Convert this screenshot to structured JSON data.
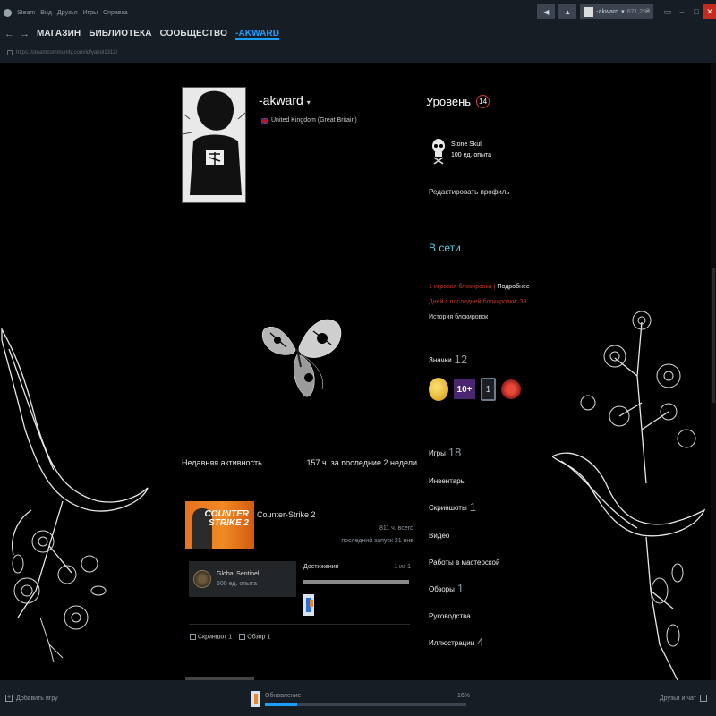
{
  "menu": [
    "Steam",
    "Вид",
    "Друзья",
    "Игры",
    "Справка"
  ],
  "titlebar": {
    "username": "-akward",
    "balance": "671,29₴"
  },
  "nav": {
    "items": [
      "МАГАЗИН",
      "БИБЛИОТЕКА",
      "СООБЩЕСТВО",
      "-AKWARD"
    ]
  },
  "url": "https://steamcommunity.com/id/yahol1312/",
  "profile": {
    "name": "-akward",
    "country": "United Kingdom (Great Britain)"
  },
  "recent": {
    "title": "Недавняя активность",
    "hours": "157 ч. за последние 2 недели",
    "game": {
      "name": "Counter-Strike 2",
      "logo_line1": "COUNTER",
      "logo_line2": "STRIKE 2",
      "total": "811 ч. всего",
      "last": "последний запуск 21 янв"
    },
    "badge": {
      "name": "Global Sentinel",
      "xp": "500 ед. опыта"
    },
    "achievements": {
      "label": "Достижения",
      "count": "1 из 1",
      "progress": 1.0
    },
    "screenshot": "Скриншот 1",
    "review": "Обзор 1"
  },
  "sidebar": {
    "level_label": "Уровень",
    "level": "14",
    "featured_badge": {
      "name": "Stone Skull",
      "xp": "100 ед. опыта"
    },
    "edit_profile": "Редактировать профиль",
    "status": "В сети",
    "ban_line1": "1 игровая блокировка |",
    "ban_more": "Подробнее",
    "ban_line2": "Дней с последней блокировки: 38",
    "ban_history": "История блокировок",
    "badges_label": "Значки",
    "badges_count": "12",
    "badge_tiles": [
      "10+",
      "1"
    ],
    "games_label": "Игры",
    "games_count": "18",
    "inventory": "Инвентарь",
    "screenshots_label": "Скриншоты",
    "screenshots_count": "1",
    "videos": "Видео",
    "workshop": "Работы в мастерской",
    "reviews_label": "Обзоры",
    "reviews_count": "1",
    "guides": "Руководства",
    "artwork_label": "Иллюстрации",
    "artwork_count": "4"
  },
  "bottom": {
    "add_game": "Добавить игру",
    "download_label": "Обновление",
    "download_pct": "16%",
    "download_progress": 0.16,
    "friends": "Друзья и чат"
  },
  "colors": {
    "accent": "#1a9fff",
    "online": "#57cbde",
    "ban": "#c2362c",
    "level_ring": "#d23c3c"
  }
}
